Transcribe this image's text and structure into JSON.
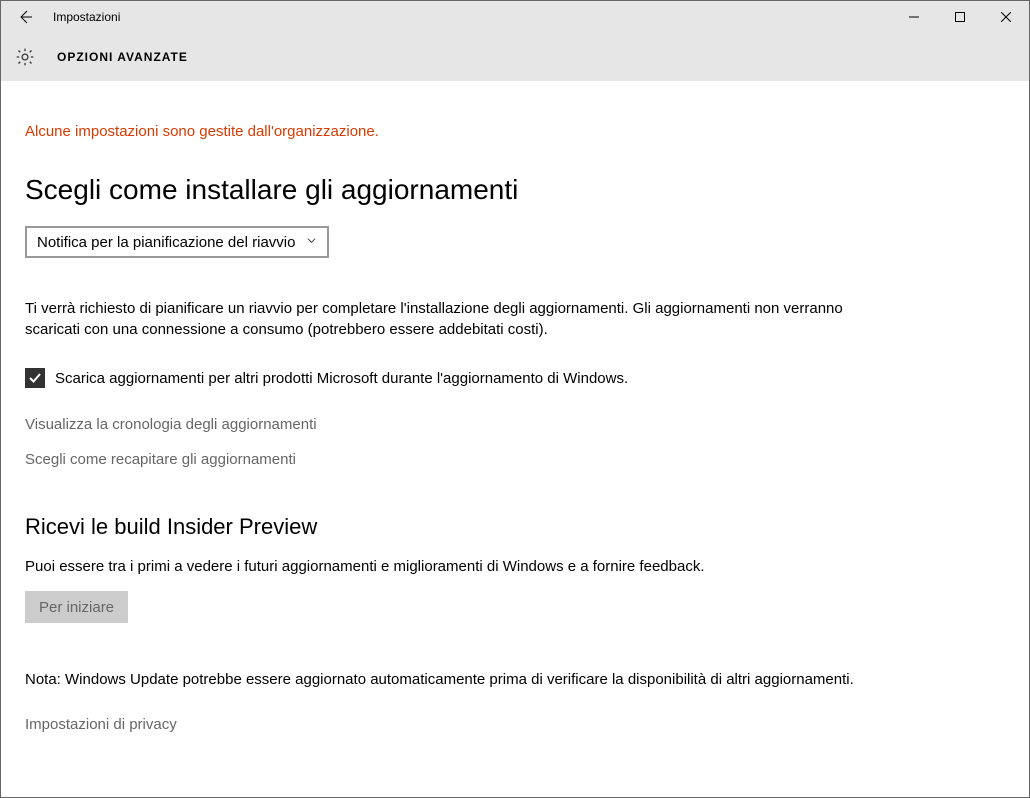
{
  "titlebar": {
    "title": "Impostazioni"
  },
  "header": {
    "title": "OPZIONI AVANZATE"
  },
  "org_notice": "Alcune impostazioni sono gestite dall'organizzazione.",
  "section1": {
    "title": "Scegli come installare gli aggiornamenti",
    "dropdown_value": "Notifica per la pianificazione del riavvio",
    "description": "Ti verrà richiesto di pianificare un riavvio per completare l'installazione degli aggiornamenti. Gli aggiornamenti non verranno scaricati con una connessione a consumo (potrebbero essere addebitati costi).",
    "checkbox_label": "Scarica aggiornamenti per altri prodotti Microsoft durante l'aggiornamento di Windows.",
    "link_history": "Visualizza la cronologia degli aggiornamenti",
    "link_delivery": "Scegli come recapitare gli aggiornamenti"
  },
  "section2": {
    "title": "Ricevi le build Insider Preview",
    "description": "Puoi essere tra i primi a vedere i futuri aggiornamenti e miglioramenti di Windows e a fornire feedback.",
    "button_label": "Per iniziare"
  },
  "note": "Nota: Windows Update potrebbe essere aggiornato automaticamente prima di verificare la disponibilità di altri aggiornamenti.",
  "privacy_link": "Impostazioni di privacy"
}
